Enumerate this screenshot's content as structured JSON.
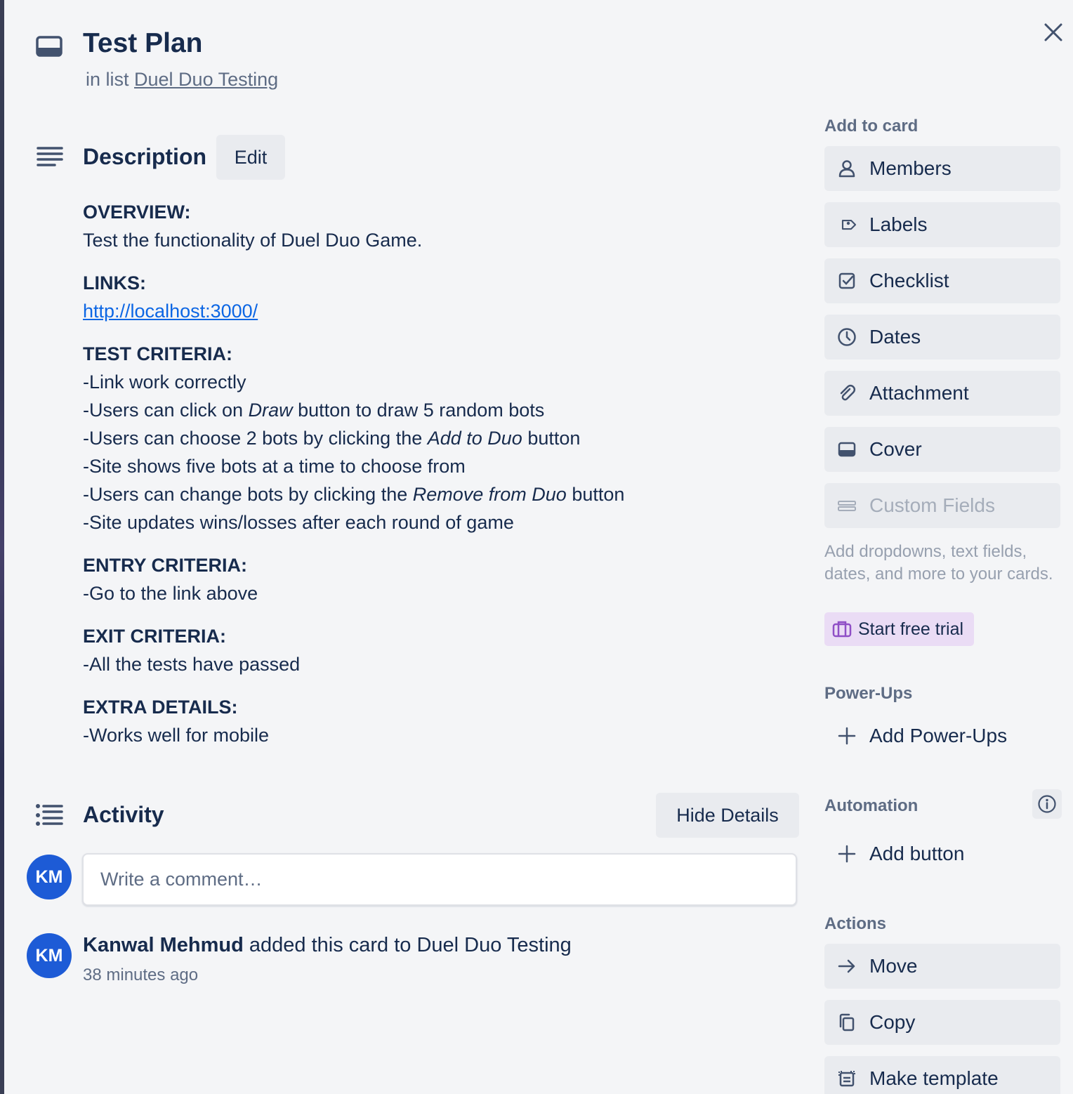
{
  "card": {
    "title": "Test Plan",
    "in_list_prefix": "in list",
    "list_name": "Duel Duo Testing"
  },
  "description": {
    "heading": "Description",
    "edit_label": "Edit",
    "overview_h": "OVERVIEW:",
    "overview_text": "Test the functionality of Duel Duo Game.",
    "links_h": "LINKS:",
    "link": "http://localhost:3000/",
    "test_h": "TEST CRITERIA:",
    "test_1": "-Link work correctly",
    "test_2_a": "-Users can click on ",
    "test_2_em": "Draw",
    "test_2_b": " button to draw 5 random bots",
    "test_3_a": "-Users can choose 2 bots by clicking the ",
    "test_3_em": "Add to Duo",
    "test_3_b": " button",
    "test_4": "-Site shows five bots at a time to choose from",
    "test_5_a": "-Users can change bots by clicking the ",
    "test_5_em": "Remove from Duo",
    "test_5_b": " button",
    "test_6": "-Site updates wins/losses after each round of game",
    "entry_h": "ENTRY CRITERIA:",
    "entry_1": "-Go to the link above",
    "exit_h": "EXIT CRITERIA:",
    "exit_1": "-All the tests have passed",
    "extra_h": "EXTRA DETAILS:",
    "extra_1": "-Works well for mobile"
  },
  "activity": {
    "heading": "Activity",
    "hide_details": "Hide Details",
    "comment_placeholder": "Write a comment…",
    "avatar_initials": "KM",
    "entry_user": "Kanwal Mehmud",
    "entry_text": " added this card to Duel Duo Testing",
    "entry_time": "38 minutes ago"
  },
  "sidebar": {
    "add_to_card": "Add to card",
    "members": "Members",
    "labels": "Labels",
    "checklist": "Checklist",
    "dates": "Dates",
    "attachment": "Attachment",
    "cover": "Cover",
    "custom_fields": "Custom Fields",
    "custom_fields_note": "Add dropdowns, text fields, dates, and more to your cards.",
    "start_trial": "Start free trial",
    "power_ups": "Power-Ups",
    "add_power_ups": "Add Power-Ups",
    "automation": "Automation",
    "add_button": "Add button",
    "actions": "Actions",
    "move": "Move",
    "copy": "Copy",
    "make_template": "Make template"
  },
  "colors": {
    "background": "#f4f5f7",
    "text": "#172b4d",
    "muted": "#5e6c84",
    "button_bg": "#e9ebef",
    "link": "#0c66e4",
    "avatar": "#1d5bd6",
    "trial_bg": "#eadcf5",
    "trial_icon": "#8f4fc6"
  }
}
